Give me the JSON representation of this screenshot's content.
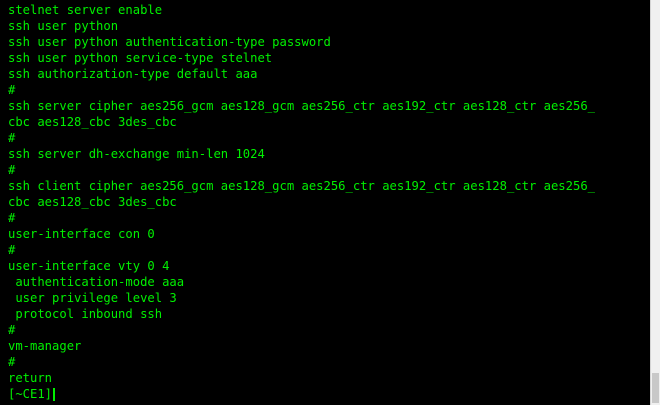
{
  "terminal": {
    "text_color": "#00f000",
    "background_color": "#000000",
    "lines": [
      "stelnet server enable",
      "ssh user python",
      "ssh user python authentication-type password",
      "ssh user python service-type stelnet",
      "ssh authorization-type default aaa",
      "#",
      "ssh server cipher aes256_gcm aes128_gcm aes256_ctr aes192_ctr aes128_ctr aes256_",
      "cbc aes128_cbc 3des_cbc",
      "#",
      "ssh server dh-exchange min-len 1024",
      "#",
      "ssh client cipher aes256_gcm aes128_gcm aes256_ctr aes192_ctr aes128_ctr aes256_",
      "cbc aes128_cbc 3des_cbc",
      "#",
      "user-interface con 0",
      "#",
      "user-interface vty 0 4",
      " authentication-mode aaa",
      " user privilege level 3",
      " protocol inbound ssh",
      "#",
      "vm-manager",
      "#",
      "return"
    ],
    "prompt": "[~CE1]"
  }
}
